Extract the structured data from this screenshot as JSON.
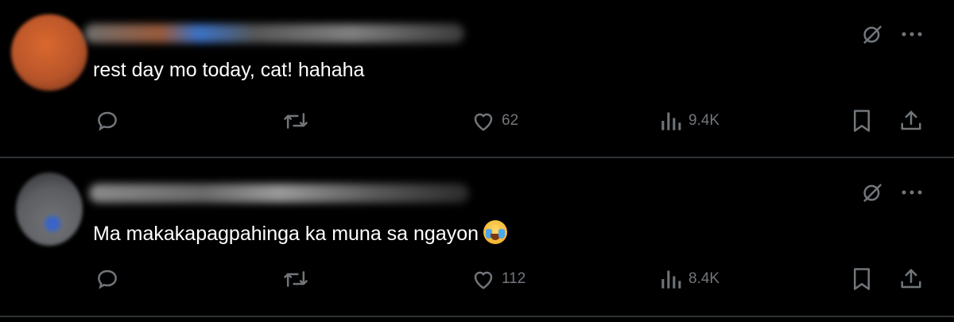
{
  "replies": [
    {
      "text": "rest day mo today, cat! hahaha",
      "likes": "62",
      "views": "9.4K",
      "avatar_color": "#c85a2c"
    },
    {
      "text": "Ma makakapagpahinga ka muna sa ngayon",
      "emoji": "face-with-tears-of-joy",
      "likes": "112",
      "views": "8.4K",
      "avatar_color": "#5f6165"
    }
  ],
  "icons": {
    "reply": "speech-bubble-icon",
    "repost": "repost-arrows-icon",
    "like": "heart-icon",
    "views": "bar-chart-icon",
    "bookmark": "bookmark-icon",
    "share": "share-upload-icon",
    "grok": "grok-slash-circle-icon",
    "more": "ellipsis-icon"
  },
  "colors": {
    "background": "#000000",
    "text": "#ffffff",
    "muted": "#71767b",
    "divider": "#2f3336"
  }
}
